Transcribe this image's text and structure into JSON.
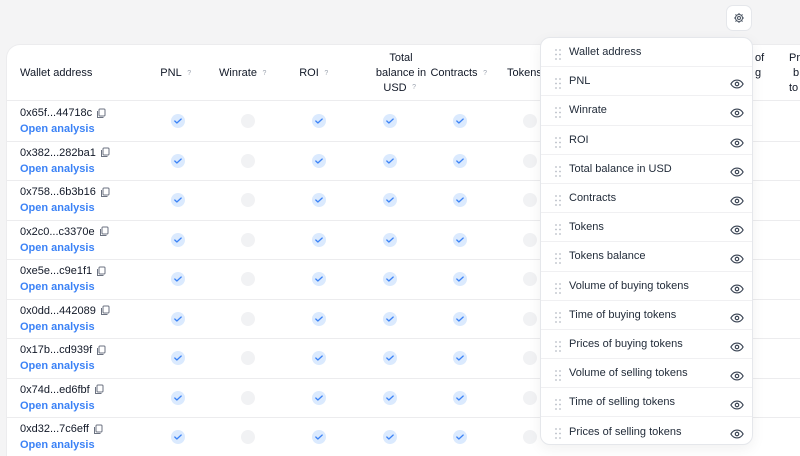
{
  "table": {
    "headers": {
      "wallet": "Wallet address",
      "pnl": "PNL",
      "winrate": "Winrate",
      "roi": "ROI",
      "balance_l1": "Total",
      "balance_l2": "balance in",
      "balance_l3": "USD",
      "contracts": "Contracts",
      "tokens": "Tokens",
      "cut_of": "of",
      "cut_g": "g",
      "cut_pr": "Pr",
      "cut_b": "b",
      "cut_to": "to"
    },
    "help_glyph": "?",
    "open_label": "Open analysis",
    "rows": [
      {
        "address": "0x65f...44718c",
        "winrate": false,
        "tokens": false
      },
      {
        "address": "0x382...282ba1",
        "winrate": false,
        "tokens": false
      },
      {
        "address": "0x758...6b3b16",
        "winrate": false,
        "tokens": false
      },
      {
        "address": "0x2c0...c3370e",
        "winrate": false,
        "tokens": false
      },
      {
        "address": "0xe5e...c9e1f1",
        "winrate": false,
        "tokens": false
      },
      {
        "address": "0x0dd...442089",
        "winrate": false,
        "tokens": false
      },
      {
        "address": "0x17b...cd939f",
        "winrate": false,
        "tokens": false
      },
      {
        "address": "0x74d...ed6fbf",
        "winrate": false,
        "tokens": false
      },
      {
        "address": "0xd32...7c6eff",
        "winrate": false,
        "tokens": false
      }
    ]
  },
  "columns_menu": {
    "items": [
      {
        "label": "Wallet address",
        "eye": false
      },
      {
        "label": "PNL",
        "eye": true
      },
      {
        "label": "Winrate",
        "eye": true
      },
      {
        "label": "ROI",
        "eye": true
      },
      {
        "label": "Total balance in USD",
        "eye": true
      },
      {
        "label": "Contracts",
        "eye": true
      },
      {
        "label": "Tokens",
        "eye": true
      },
      {
        "label": "Tokens balance",
        "eye": true
      },
      {
        "label": "Volume of buying tokens",
        "eye": true
      },
      {
        "label": "Time of buying tokens",
        "eye": true
      },
      {
        "label": "Prices of buying tokens",
        "eye": true
      },
      {
        "label": "Volume of selling tokens",
        "eye": true
      },
      {
        "label": "Time of selling tokens",
        "eye": true
      },
      {
        "label": "Prices of selling tokens",
        "eye": true
      }
    ]
  },
  "colors": {
    "accent": "#3b82f6",
    "check_bg": "#dbeafe",
    "empty_bg": "#f1f2f4"
  },
  "icons": {
    "settings": "gear-icon",
    "copy": "copy-icon",
    "check": "check-icon",
    "drag": "drag-handle-icon",
    "visibility": "eye-icon"
  }
}
